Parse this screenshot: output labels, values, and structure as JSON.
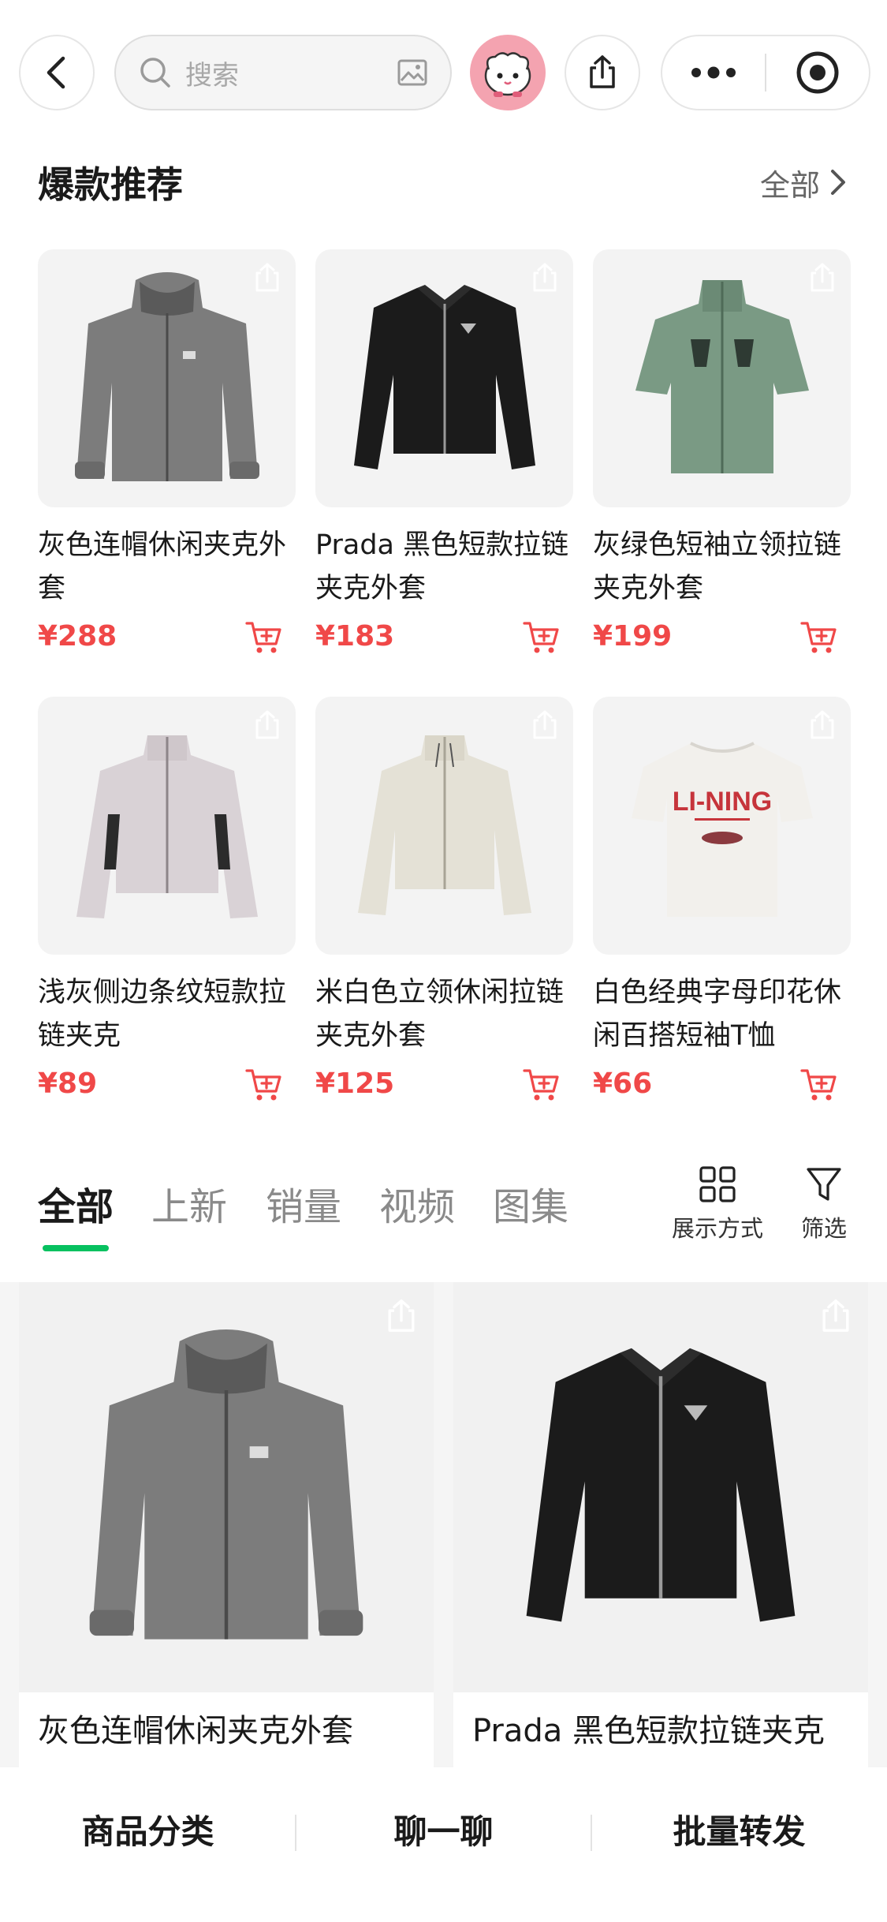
{
  "topbar": {
    "search_placeholder": "搜索"
  },
  "section": {
    "title": "爆款推荐",
    "more_label": "全部"
  },
  "hot_products": [
    {
      "name": "灰色连帽休闲夹克外套",
      "price": "¥288",
      "image": "gray-hooded-jacket"
    },
    {
      "name": "Prada 黑色短款拉链夹克外套",
      "price": "¥183",
      "image": "black-cropped-jacket"
    },
    {
      "name": "灰绿色短袖立领拉链夹克外套",
      "price": "¥199",
      "image": "sage-short-sleeve-jacket"
    },
    {
      "name": "浅灰侧边条纹短款拉链夹克",
      "price": "¥89",
      "image": "light-gray-stripe-jacket"
    },
    {
      "name": "米白色立领休闲拉链夹克外套",
      "price": "¥125",
      "image": "off-white-jacket"
    },
    {
      "name": "白色经典字母印花休闲百搭短袖T恤",
      "price": "¥66",
      "image": "white-logo-tshirt"
    }
  ],
  "tshirt_print": "LI-NING",
  "tabs": [
    {
      "label": "全部",
      "active": true
    },
    {
      "label": "上新",
      "active": false
    },
    {
      "label": "销量",
      "active": false
    },
    {
      "label": "视频",
      "active": false
    },
    {
      "label": "图集",
      "active": false
    }
  ],
  "tools": {
    "display_mode": "展示方式",
    "filter": "筛选"
  },
  "big_products": [
    {
      "name": "灰色连帽休闲夹克外套"
    },
    {
      "name": "Prada 黑色短款拉链夹克"
    }
  ],
  "bottom_bar": {
    "category": "商品分类",
    "chat": "聊一聊",
    "forward": "批量转发"
  },
  "colors": {
    "price_red": "#f04848",
    "accent_green": "#07c160",
    "avatar_pink": "#f4a3b0"
  }
}
